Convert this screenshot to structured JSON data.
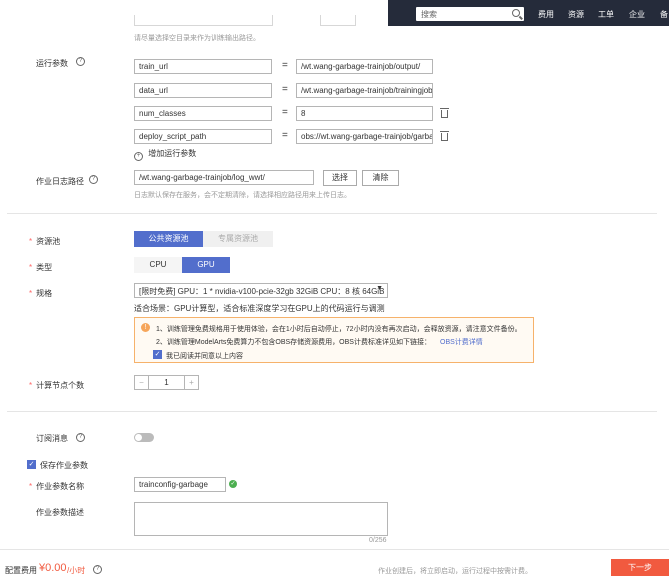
{
  "topnav": {
    "search_placeholder": "搜索",
    "items": [
      "费用",
      "资源",
      "工单",
      "企业",
      "备"
    ]
  },
  "output_path": {
    "hint": "请尽量选择空目录来作为训练输出路径。"
  },
  "run_params": {
    "label": "运行参数",
    "help": "?",
    "rows": [
      {
        "key": "train_url",
        "value": "/wt.wang-garbage-trainjob/output/"
      },
      {
        "key": "data_url",
        "value": "/wt.wang-garbage-trainjob/trainingjob_"
      },
      {
        "key": "num_classes",
        "value": "8"
      },
      {
        "key": "deploy_script_path",
        "value": "obs://wt.wang-garbage-trainjob/garbage"
      }
    ],
    "eq": "=",
    "add_label": "增加运行参数"
  },
  "log_path": {
    "label": "作业日志路径",
    "value": "/wt.wang-garbage-trainjob/log_wwt/",
    "select_label": "选择",
    "clear_label": "清除",
    "hint": "日志默认保存在服务，会不定期清除，请选择相应路径用来上传日志。"
  },
  "resource_pool": {
    "label": "资源池",
    "options": [
      "公共资源池",
      "专属资源池"
    ]
  },
  "type": {
    "label": "类型",
    "options": [
      "CPU",
      "GPU"
    ]
  },
  "spec": {
    "label": "规格",
    "value": "[限时免费] GPU：1 * nvidia-v100-pcie-32gb 32GiB CPU：8 核 64GiB",
    "scene": "适合场景：GPU计算型，适合标准深度学习在GPU上的代码运行与调测"
  },
  "notice": {
    "line1": "1、训练管理免费规格用于使用体验，会在1小时后自动停止，72小时内没有再次启动，会释放资源，请注意文件备份。",
    "line2": "2、训练管理ModelArts免费算力不包含OBS存储资源费用，OBS计费标准详见如下链接：",
    "link": "OBS计费详情",
    "checkbox_label": "我已阅读并同意以上内容"
  },
  "nodes": {
    "label": "计算节点个数",
    "minus": "−",
    "value": "1",
    "plus": "+"
  },
  "subscribe": {
    "label": "订阅消息"
  },
  "save_params": {
    "label": "保存作业参数"
  },
  "param_name": {
    "label": "作业参数名称",
    "value": "trainconfig-garbage"
  },
  "param_desc": {
    "label": "作业参数描述",
    "counter": "0/256"
  },
  "footer": {
    "cost_label": "配置费用",
    "price": "¥0.00",
    "unit": "/小时",
    "info": "作业创建后，将立即启动，运行过程中按需计费。",
    "next": "下一步"
  }
}
